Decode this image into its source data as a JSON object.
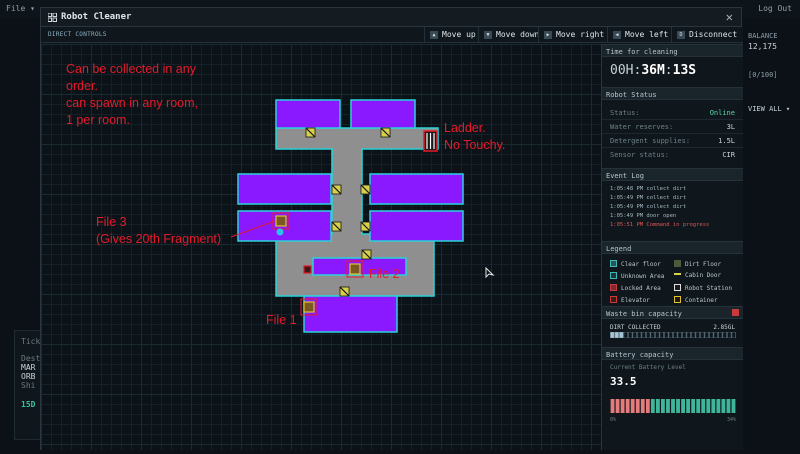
{
  "desktop": {
    "menu_file": "File ▾",
    "top_right": [
      "Log Out"
    ],
    "left_card": {
      "header": "Ticke",
      "line1": "Dest",
      "line2": "MAR",
      "line3": "ORB",
      "line4": "Shi",
      "badge": "15D"
    },
    "right_info": {
      "balance_label": "BALANCE",
      "balance_value": "12,175",
      "counter": "[0/100]",
      "view_all": "VIEW ALL ▾"
    }
  },
  "window": {
    "title": "Robot Cleaner",
    "close": "✕"
  },
  "toolbar": {
    "label": "DIRECT CONTROLS",
    "buttons": [
      {
        "key": "▲",
        "label": "Move up"
      },
      {
        "key": "▼",
        "label": "Move down"
      },
      {
        "key": "▶",
        "label": "Move right"
      },
      {
        "key": "◀",
        "label": "Move left"
      },
      {
        "key": "D",
        "label": "Disconnect"
      }
    ]
  },
  "time": {
    "header": "Time for cleaning",
    "hours": "00H",
    "minutes": "36M",
    "seconds": "13S"
  },
  "status": {
    "header": "Robot Status",
    "rows": [
      {
        "k": "Status:",
        "v": "Online"
      },
      {
        "k": "Water reserves:",
        "v": "3L"
      },
      {
        "k": "Detergent supplies:",
        "v": "1.5L"
      },
      {
        "k": "Sensor status:",
        "v": "CIR"
      }
    ]
  },
  "events": {
    "header": "Event Log",
    "lines": [
      "1:05:48 PM collect dirt",
      "1:05:49 PM collect dirt",
      "1:05:49 PM collect dirt",
      "1:05:49 PM door open",
      "1:05:51 PM Command in progress"
    ]
  },
  "legend": {
    "header": "Legend",
    "items": [
      {
        "label": "Clear floor",
        "color": "#2b5556"
      },
      {
        "label": "Dirt Floor",
        "color": "#4f5a3a"
      },
      {
        "label": "Unknown Area",
        "color": "#1d3438"
      },
      {
        "label": "Cabin Door",
        "color": "#d8d04a"
      },
      {
        "label": "Locked Area",
        "color": "#7a2b35"
      },
      {
        "label": "Robot Station",
        "color": "#e0e0e0"
      },
      {
        "label": "Elevator",
        "color": "#c93a3a"
      },
      {
        "label": "Container",
        "color": "#e2c02d"
      }
    ]
  },
  "waste": {
    "header": "Waste bin capacity",
    "label": "DIRT COLLECTED",
    "value": "2.85GL",
    "fill_fraction": 0.1
  },
  "battery": {
    "header": "Battery capacity",
    "label": "Current Battery Level",
    "value": "33.5",
    "scale_min": "0%",
    "scale_max": "34%",
    "fill_fraction": 0.33
  },
  "annotations": {
    "top_note": "Can be collected in any\norder.\ncan spawn in any room,\n1 per room.",
    "ladder_note": "Ladder.\nNo Touchy.",
    "file3": "File 3\n(Gives 20th Fragment)",
    "file2": "File 2",
    "file1": "File 1"
  },
  "colors": {
    "room": "#8a19ff",
    "room_border": "#2ad3d9",
    "corridor": "#8f8f8f",
    "annotation": "#e51b2b"
  }
}
